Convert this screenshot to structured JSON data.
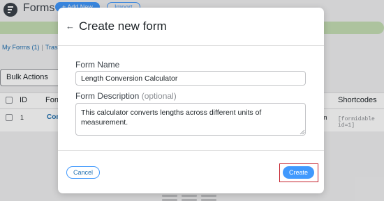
{
  "background": {
    "page_title": "Forms",
    "add_new_label": "+ Add New",
    "import_label": "Import",
    "links": {
      "my_forms": "My Forms (1)",
      "separator": "|",
      "trash": "Trash"
    },
    "bulk_actions_label": "Bulk Actions",
    "table": {
      "headers": {
        "id": "ID",
        "form": "Form",
        "shortcodes": "Shortcodes"
      },
      "row": {
        "id": "1",
        "form": "Con",
        "partial": "m",
        "shortcode": "[formidable id=1]"
      }
    }
  },
  "modal": {
    "back_icon": "←",
    "title": "Create new form",
    "form_name_label": "Form Name",
    "form_name_value": "Length Conversion Calculator",
    "description_label": "Form Description",
    "description_optional": "(optional)",
    "description_value": "This calculator converts lengths across different units of measurement.",
    "cancel_label": "Cancel",
    "create_label": "Create"
  },
  "colors": {
    "accent": "#4199fd",
    "highlight": "#c41e2a",
    "notice": "#c5dfb4"
  }
}
